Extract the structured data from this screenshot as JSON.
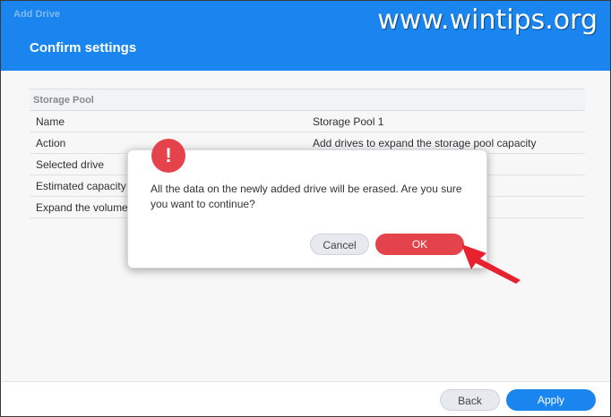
{
  "window": {
    "app_title": "Add Drive",
    "page_title": "Confirm settings",
    "watermark": "www.wintips.org"
  },
  "table": {
    "section": "Storage Pool",
    "rows": [
      {
        "label": "Name",
        "value": "Storage Pool 1"
      },
      {
        "label": "Action",
        "value": "Add drives to expand the storage pool capacity"
      },
      {
        "label": "Selected drive",
        "value": ""
      },
      {
        "label": "Estimated capacity",
        "value": ""
      },
      {
        "label": "Expand the volume",
        "value": ""
      }
    ]
  },
  "footer": {
    "back": "Back",
    "apply": "Apply"
  },
  "dialog": {
    "icon": "!",
    "message": "All the data on the newly added drive will be erased. Are you sure you want to continue?",
    "cancel": "Cancel",
    "ok": "OK"
  },
  "colors": {
    "header": "#1a85ef",
    "danger": "#e4434c",
    "arrow": "#e8212e"
  }
}
